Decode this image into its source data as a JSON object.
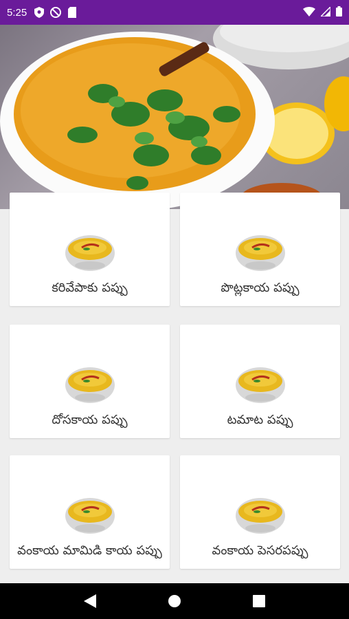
{
  "status_bar": {
    "time": "5:25",
    "icons_left": [
      "shield-icon",
      "no-disturb-icon",
      "sd-card-icon"
    ],
    "icons_right": [
      "wifi-icon",
      "signal-icon",
      "battery-icon"
    ]
  },
  "colors": {
    "status_bar": "#6a1b9a",
    "background": "#eeeeee",
    "card": "#ffffff",
    "nav_bar": "#000000"
  },
  "hero": {
    "description_icon": "dal-bowl-hero-image"
  },
  "recipes": [
    {
      "label": "కరివేపాకు పప్పు"
    },
    {
      "label": "పొట్లకాయ పప్పు"
    },
    {
      "label": "దోసకాయ పప్పు"
    },
    {
      "label": "టమాట పప్పు"
    },
    {
      "label": "వంకాయ మామిడి కాయ పప్పు"
    },
    {
      "label": "వంకాయ పెసరపప్పు"
    }
  ],
  "nav_bar": {
    "buttons": [
      "back-icon",
      "home-icon",
      "recents-icon"
    ]
  }
}
